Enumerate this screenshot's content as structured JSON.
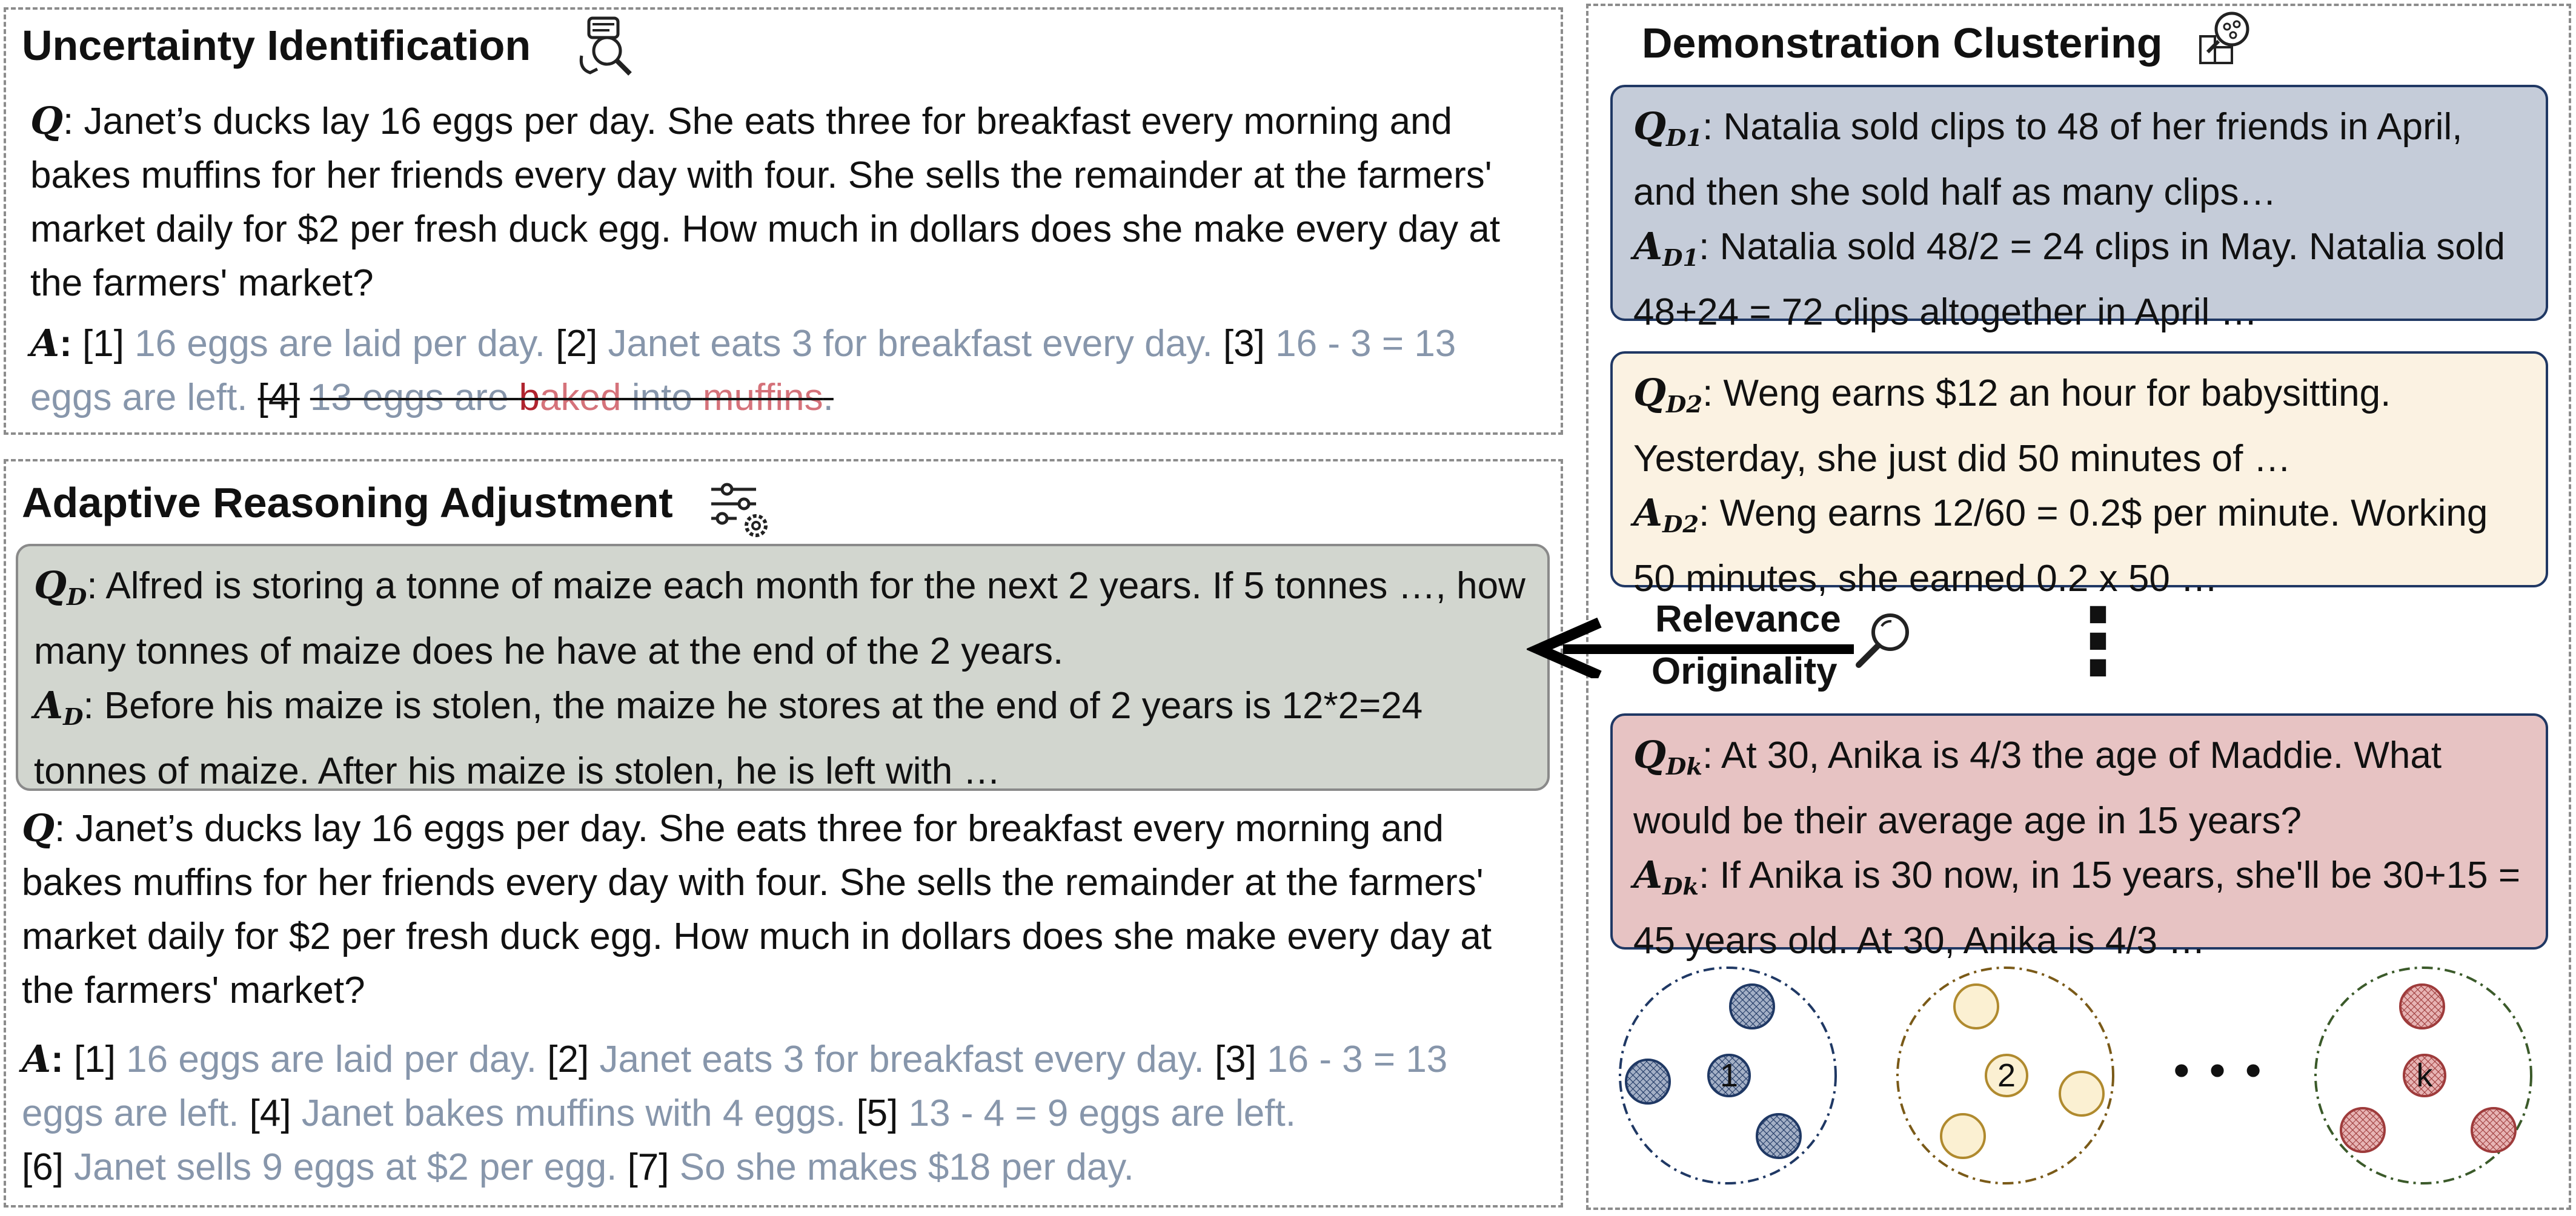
{
  "uncertainty": {
    "title": "Uncertainty Identification",
    "question": {
      "symbol": "Q",
      "text": ": Janet’s ducks lay 16 eggs per day. She eats three for breakfast every morning and bakes muffins for her friends every day with four. She sells the remainder at the farmers' market daily for $2 per fresh duck egg. How much in dollars does she make every day at the farmers' market?"
    },
    "answer": {
      "symbol": "A",
      "sep": ":",
      "m1": "[1]",
      "s1": "16 eggs are laid per day.",
      "m2": "[2]",
      "s2": "Janet eats 3 for breakfast every day.",
      "m3": "[3]",
      "s3": "16 - 3 = 13 eggs are left.",
      "m4": "[4]",
      "s4_a": "13 eggs are ",
      "s4_b": "b",
      "s4_c": "aked",
      "s4_d": " into ",
      "s4_e": "muffins",
      "s4_f": "."
    }
  },
  "adaptive": {
    "title": "Adaptive Reasoning Adjustment",
    "demo": {
      "q_symbol": "Q",
      "q_sub": "D",
      "q_text": ": Alfred is storing a tonne of maize each month for the next 2 years.  If 5 tonnes …, how many tonnes of maize does he have at the end of the 2 years.",
      "a_symbol": "A",
      "a_sub": "D",
      "a_text": ": Before his maize is stolen, the maize he stores at the end of 2 years is 12*2=24 tonnes of maize. After his maize is stolen, he is left with …"
    },
    "question": {
      "symbol": "Q",
      "text": ": Janet’s ducks lay 16 eggs per day. She eats three for breakfast every morning and bakes muffins for her friends every day with four. She sells the remainder at the farmers' market daily for $2 per fresh duck egg. How much in dollars does she make every day at the farmers' market?"
    },
    "answer": {
      "symbol": "A",
      "sep": ":",
      "m1": "[1]",
      "s1": "16 eggs are laid per day.",
      "m2": "[2]",
      "s2": "Janet eats 3 for breakfast every day.",
      "m3": "[3]",
      "s3": "16 - 3 = 13 eggs are left.",
      "m4": "[4]",
      "s4": "Janet bakes muffins with 4 eggs.",
      "m5": "[5]",
      "s5": "13 - 4 = 9 eggs are left.",
      "m6": "[6]",
      "s6": "Janet sells 9 eggs at $2 per egg.",
      "m7": "[7]",
      "s7": "So she makes $18 per day."
    }
  },
  "clustering": {
    "title": "Demonstration Clustering",
    "demos": [
      {
        "q_symbol": "Q",
        "q_sub": "D1",
        "q_text": ": Natalia sold clips to 48 of her friends in April, and then she sold half as many clips…",
        "a_symbol": "A",
        "a_sub": "D1",
        "a_text": ": Natalia sold 48/2 = 24 clips in May. Natalia sold 48+24 = 72 clips altogether in April …",
        "fill": "#c5ccd9"
      },
      {
        "q_symbol": "Q",
        "q_sub": "D2",
        "q_text": ": Weng earns $12 an hour for babysitting. Yesterday, she just did 50 minutes of …",
        "a_symbol": "A",
        "a_sub": "D2",
        "a_text": ": Weng earns 12/60 = 0.2$ per minute. Working 50 minutes, she earned 0.2 x 50 …",
        "fill": "#fbf2e2"
      },
      {
        "q_symbol": "Q",
        "q_sub": "Dk",
        "q_text": ": At 30, Anika is 4/3 the age of Maddie. What would be their average age in 15 years?",
        "a_symbol": "A",
        "a_sub": "Dk",
        "a_text": ": If Anika is 30 now, in 15 years, she'll be 30+15 = 45 years old. At 30, Anika is 4/3 …",
        "fill": "#e7c3c3"
      }
    ],
    "vertical_ellipsis": "⋮",
    "relevance_label": "Relevance",
    "originality_label": "Originality",
    "clusters": [
      {
        "label": "1",
        "dot_color": "#1f3864",
        "dot_fill": "#a4b0c6",
        "ring_color": "#1f3864"
      },
      {
        "label": "2",
        "dot_color": "#b08a2e",
        "dot_fill": "#fbf0d2",
        "ring_color": "#7a5a18"
      },
      {
        "label": "k",
        "dot_color": "#9e3b3b",
        "dot_fill": "#e7b4b4",
        "ring_color": "#3b5a2a"
      }
    ],
    "horizontal_ellipsis": "• • •"
  },
  "colors": {
    "panel_border": "#8c8c8c",
    "gray_text": "#8796ab",
    "struck_red": "#d5727a",
    "demo_green": "#d2d6cf",
    "demo_green_border": "#8a8a8a",
    "box_border": "#203864"
  },
  "icons": [
    "magnifier-hand-icon",
    "sliders-gear-icon",
    "cluster-magnifier-icon",
    "magnifier-icon",
    "left-arrow-icon"
  ]
}
